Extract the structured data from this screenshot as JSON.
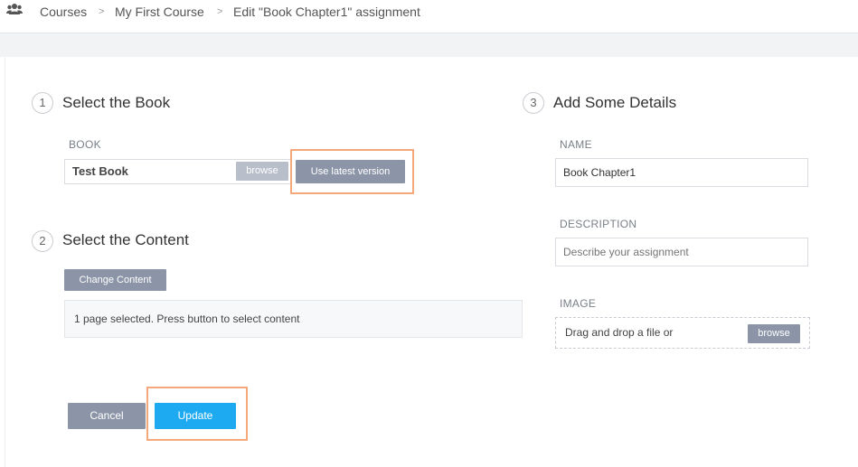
{
  "breadcrumb": {
    "icon": "users-icon",
    "items": [
      "Courses",
      "My First Course",
      "Edit \"Book Chapter1\" assignment"
    ],
    "separator": ">"
  },
  "step1": {
    "number": "1",
    "title": "Select the Book",
    "book_label": "BOOK",
    "book_value": "Test Book",
    "browse_label": "browse",
    "latest_label": "Use latest version"
  },
  "step2": {
    "number": "2",
    "title": "Select the Content",
    "change_label": "Change Content",
    "status_text": "1 page selected. Press button to select content"
  },
  "step3": {
    "number": "3",
    "title": "Add Some Details",
    "name_label": "NAME",
    "name_value": "Book Chapter1",
    "description_label": "DESCRIPTION",
    "description_placeholder": "Describe your assignment",
    "image_label": "IMAGE",
    "drop_text": "Drag and drop a file or",
    "browse_label": "browse"
  },
  "actions": {
    "cancel_label": "Cancel",
    "update_label": "Update"
  },
  "colors": {
    "primary": "#1eaaf1",
    "secondary_button": "#8c95a8",
    "highlight": "#f5a97a"
  }
}
